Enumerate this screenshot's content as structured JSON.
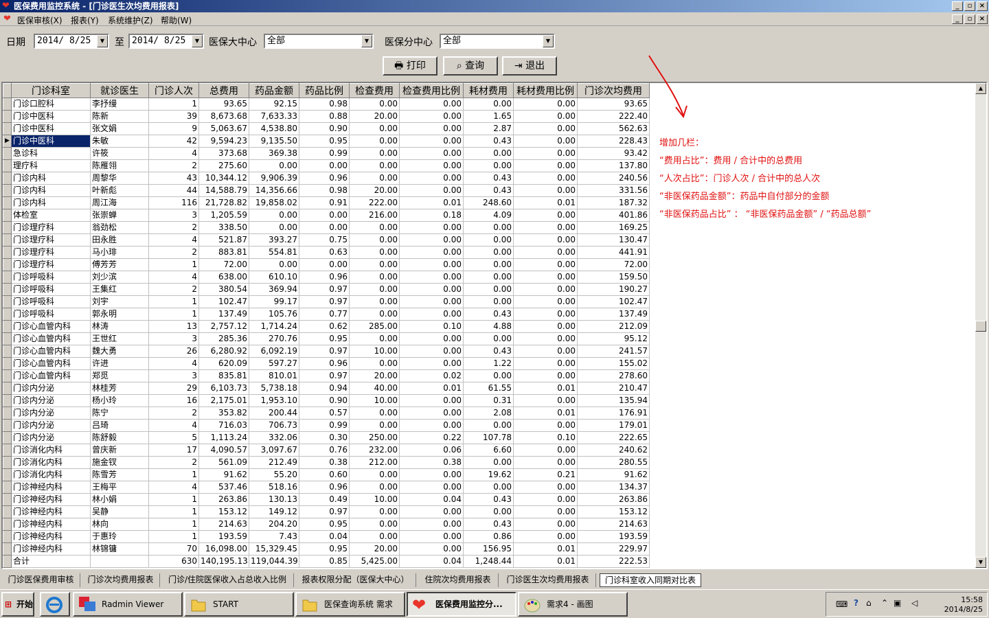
{
  "window": {
    "title": "医保费用监控系统 - [门诊医生次均费用报表]"
  },
  "menu": [
    "医保审核(X)",
    "报表(Y)",
    "系统维护(Z)",
    "帮助(W)"
  ],
  "filters": {
    "date_label": "日期",
    "date_from": "2014/ 8/25",
    "to_label": "至",
    "date_to": "2014/ 8/25",
    "center_label": "医保大中心",
    "center_value": "全部",
    "sub_label": "医保分中心",
    "sub_value": "全部"
  },
  "buttons": {
    "print": "打印",
    "query": "查询",
    "exit": "退出"
  },
  "columns": [
    "门诊科室",
    "就诊医生",
    "门诊人次",
    "总费用",
    "药品金额",
    "药品比例",
    "检查费用",
    "检查费用比例",
    "耗材费用",
    "耗材费用比例",
    "门诊次均费用"
  ],
  "rows": [
    [
      "门诊口腔科",
      "李抒缦",
      "1",
      "93.65",
      "92.15",
      "0.98",
      "0.00",
      "0.00",
      "0.00",
      "0.00",
      "93.65"
    ],
    [
      "门诊中医科",
      "陈新",
      "39",
      "8,673.68",
      "7,633.33",
      "0.88",
      "20.00",
      "0.00",
      "1.65",
      "0.00",
      "222.40"
    ],
    [
      "门诊中医科",
      "张文娟",
      "9",
      "5,063.67",
      "4,538.80",
      "0.90",
      "0.00",
      "0.00",
      "2.87",
      "0.00",
      "562.63"
    ],
    [
      "门诊中医科",
      "朱敏",
      "42",
      "9,594.23",
      "9,135.50",
      "0.95",
      "0.00",
      "0.00",
      "0.43",
      "0.00",
      "228.43"
    ],
    [
      "急诊科",
      "许筱",
      "4",
      "373.68",
      "369.38",
      "0.99",
      "0.00",
      "0.00",
      "0.00",
      "0.00",
      "93.42"
    ],
    [
      "理疗科",
      "陈雁翎",
      "2",
      "275.60",
      "0.00",
      "0.00",
      "0.00",
      "0.00",
      "0.00",
      "0.00",
      "137.80"
    ],
    [
      "门诊内科",
      "周黎华",
      "43",
      "10,344.12",
      "9,906.39",
      "0.96",
      "0.00",
      "0.00",
      "0.43",
      "0.00",
      "240.56"
    ],
    [
      "门诊内科",
      "叶新彪",
      "44",
      "14,588.79",
      "14,356.66",
      "0.98",
      "20.00",
      "0.00",
      "0.43",
      "0.00",
      "331.56"
    ],
    [
      "门诊内科",
      "周江海",
      "116",
      "21,728.82",
      "19,858.02",
      "0.91",
      "222.00",
      "0.01",
      "248.60",
      "0.01",
      "187.32"
    ],
    [
      "体检室",
      "张崇蝉",
      "3",
      "1,205.59",
      "0.00",
      "0.00",
      "216.00",
      "0.18",
      "4.09",
      "0.00",
      "401.86"
    ],
    [
      "门诊理疗科",
      "翁劲松",
      "2",
      "338.50",
      "0.00",
      "0.00",
      "0.00",
      "0.00",
      "0.00",
      "0.00",
      "169.25"
    ],
    [
      "门诊理疗科",
      "田永胜",
      "4",
      "521.87",
      "393.27",
      "0.75",
      "0.00",
      "0.00",
      "0.00",
      "0.00",
      "130.47"
    ],
    [
      "门诊理疗科",
      "马小琲",
      "2",
      "883.81",
      "554.81",
      "0.63",
      "0.00",
      "0.00",
      "0.00",
      "0.00",
      "441.91"
    ],
    [
      "门诊理疗科",
      "傅芳芳",
      "1",
      "72.00",
      "0.00",
      "0.00",
      "0.00",
      "0.00",
      "0.00",
      "0.00",
      "72.00"
    ],
    [
      "门诊呼吸科",
      "刘少滨",
      "4",
      "638.00",
      "610.10",
      "0.96",
      "0.00",
      "0.00",
      "0.00",
      "0.00",
      "159.50"
    ],
    [
      "门诊呼吸科",
      "王集红",
      "2",
      "380.54",
      "369.94",
      "0.97",
      "0.00",
      "0.00",
      "0.00",
      "0.00",
      "190.27"
    ],
    [
      "门诊呼吸科",
      "刘宇",
      "1",
      "102.47",
      "99.17",
      "0.97",
      "0.00",
      "0.00",
      "0.00",
      "0.00",
      "102.47"
    ],
    [
      "门诊呼吸科",
      "郭永明",
      "1",
      "137.49",
      "105.76",
      "0.77",
      "0.00",
      "0.00",
      "0.43",
      "0.00",
      "137.49"
    ],
    [
      "门诊心血管内科",
      "林涛",
      "13",
      "2,757.12",
      "1,714.24",
      "0.62",
      "285.00",
      "0.10",
      "4.88",
      "0.00",
      "212.09"
    ],
    [
      "门诊心血管内科",
      "王世红",
      "3",
      "285.36",
      "270.76",
      "0.95",
      "0.00",
      "0.00",
      "0.00",
      "0.00",
      "95.12"
    ],
    [
      "门诊心血管内科",
      "魏大勇",
      "26",
      "6,280.92",
      "6,092.19",
      "0.97",
      "10.00",
      "0.00",
      "0.43",
      "0.00",
      "241.57"
    ],
    [
      "门诊心血管内科",
      "许进",
      "4",
      "620.09",
      "597.27",
      "0.96",
      "0.00",
      "0.00",
      "1.22",
      "0.00",
      "155.02"
    ],
    [
      "门诊心血管内科",
      "郑觅",
      "3",
      "835.81",
      "810.01",
      "0.97",
      "20.00",
      "0.02",
      "0.00",
      "0.00",
      "278.60"
    ],
    [
      "门诊内分泌",
      "林桂芳",
      "29",
      "6,103.73",
      "5,738.18",
      "0.94",
      "40.00",
      "0.01",
      "61.55",
      "0.01",
      "210.47"
    ],
    [
      "门诊内分泌",
      "杨小玲",
      "16",
      "2,175.01",
      "1,953.10",
      "0.90",
      "10.00",
      "0.00",
      "0.31",
      "0.00",
      "135.94"
    ],
    [
      "门诊内分泌",
      "陈宁",
      "2",
      "353.82",
      "200.44",
      "0.57",
      "0.00",
      "0.00",
      "2.08",
      "0.01",
      "176.91"
    ],
    [
      "门诊内分泌",
      "吕琦",
      "4",
      "716.03",
      "706.73",
      "0.99",
      "0.00",
      "0.00",
      "0.00",
      "0.00",
      "179.01"
    ],
    [
      "门诊内分泌",
      "陈舒毅",
      "5",
      "1,113.24",
      "332.06",
      "0.30",
      "250.00",
      "0.22",
      "107.78",
      "0.10",
      "222.65"
    ],
    [
      "门诊消化内科",
      "曾庆新",
      "17",
      "4,090.57",
      "3,097.67",
      "0.76",
      "232.00",
      "0.06",
      "6.60",
      "0.00",
      "240.62"
    ],
    [
      "门诊消化内科",
      "施金钗",
      "2",
      "561.09",
      "212.49",
      "0.38",
      "212.00",
      "0.38",
      "0.00",
      "0.00",
      "280.55"
    ],
    [
      "门诊消化内科",
      "陈雪芳",
      "1",
      "91.62",
      "55.20",
      "0.60",
      "0.00",
      "0.00",
      "19.62",
      "0.21",
      "91.62"
    ],
    [
      "门诊神经内科",
      "王梅平",
      "4",
      "537.46",
      "518.16",
      "0.96",
      "0.00",
      "0.00",
      "0.00",
      "0.00",
      "134.37"
    ],
    [
      "门诊神经内科",
      "林小娟",
      "1",
      "263.86",
      "130.13",
      "0.49",
      "10.00",
      "0.04",
      "0.43",
      "0.00",
      "263.86"
    ],
    [
      "门诊神经内科",
      "吴静",
      "1",
      "153.12",
      "149.12",
      "0.97",
      "0.00",
      "0.00",
      "0.00",
      "0.00",
      "153.12"
    ],
    [
      "门诊神经内科",
      "林向",
      "1",
      "214.63",
      "204.20",
      "0.95",
      "0.00",
      "0.00",
      "0.43",
      "0.00",
      "214.63"
    ],
    [
      "门诊神经内科",
      "于惠玲",
      "1",
      "193.59",
      "7.43",
      "0.04",
      "0.00",
      "0.00",
      "0.86",
      "0.00",
      "193.59"
    ],
    [
      "门诊神经内科",
      "林锦镛",
      "70",
      "16,098.00",
      "15,329.45",
      "0.95",
      "20.00",
      "0.00",
      "156.95",
      "0.01",
      "229.97"
    ],
    [
      "合计",
      "",
      "630",
      "140,195.13",
      "119,044.39",
      "0.85",
      "5,425.00",
      "0.04",
      "1,248.44",
      "0.01",
      "222.53"
    ]
  ],
  "notes": [
    "增加几栏：",
    "“费用占比”：费用 / 合计中的总费用",
    "“人次占比”：门诊人次 / 合计中的总人次",
    "“非医保药品金额”：药品中自付部分的金额",
    "“非医保药品占比” ： “非医保药品金额” / “药品总额”"
  ],
  "tabs": [
    "门诊医保费用审核",
    "门诊次均费用报表",
    "门诊/住院医保收入占总收入比例",
    "报表权限分配（医保大中心）",
    "住院次均费用报表",
    "门诊医生次均费用报表",
    "门诊科室收入同期对比表"
  ],
  "taskbar": {
    "start": "开始",
    "items": [
      "Radmin Viewer",
      "START",
      "医保查询系统 需求",
      "医保费用监控分...",
      "需求4 - 画图"
    ],
    "time": "15:58",
    "date": "2014/8/25"
  }
}
